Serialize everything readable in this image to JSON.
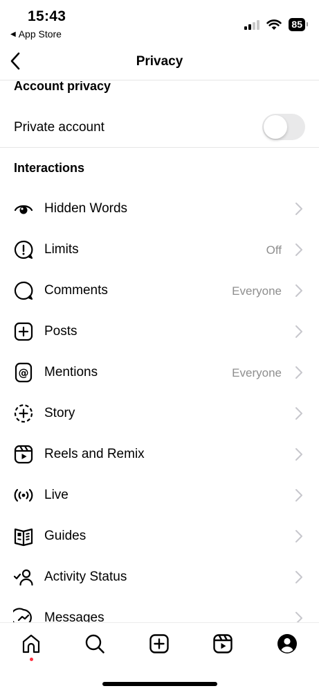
{
  "status_bar": {
    "time": "15:43",
    "back_app": "App Store",
    "battery": "85"
  },
  "nav": {
    "title": "Privacy",
    "back_icon": "chevron-left-icon"
  },
  "account_privacy": {
    "heading": "Account privacy",
    "private_label": "Private account",
    "private_enabled": false
  },
  "interactions": {
    "heading": "Interactions",
    "items": [
      {
        "label": "Hidden Words",
        "value": "",
        "icon": "eye-icon"
      },
      {
        "label": "Limits",
        "value": "Off",
        "icon": "alert-bubble-icon"
      },
      {
        "label": "Comments",
        "value": "Everyone",
        "icon": "comment-bubble-icon"
      },
      {
        "label": "Posts",
        "value": "",
        "icon": "plus-square-icon"
      },
      {
        "label": "Mentions",
        "value": "Everyone",
        "icon": "at-sign-icon"
      },
      {
        "label": "Story",
        "value": "",
        "icon": "story-plus-icon"
      },
      {
        "label": "Reels and Remix",
        "value": "",
        "icon": "reels-icon"
      },
      {
        "label": "Live",
        "value": "",
        "icon": "live-broadcast-icon"
      },
      {
        "label": "Guides",
        "value": "",
        "icon": "guide-book-icon"
      },
      {
        "label": "Activity Status",
        "value": "",
        "icon": "activity-status-icon"
      },
      {
        "label": "Messages",
        "value": "",
        "icon": "messenger-icon"
      }
    ]
  },
  "tab_bar": {
    "items": [
      "home-icon",
      "search-icon",
      "create-icon",
      "reels-icon",
      "profile-icon"
    ]
  }
}
